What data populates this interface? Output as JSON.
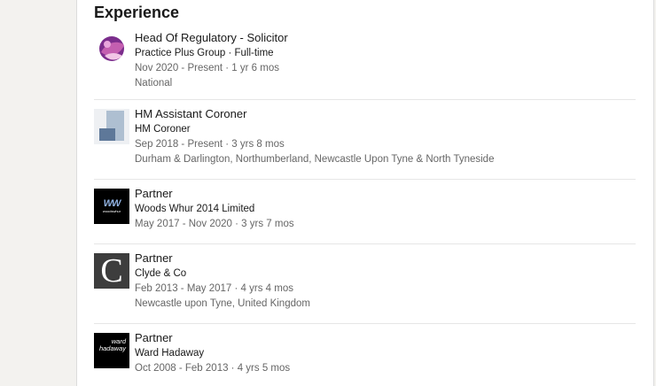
{
  "section": {
    "title": "Experience"
  },
  "entries": [
    {
      "logo": {
        "icon": "practice-plus-group-logo",
        "colors": [
          "#7b2d8c",
          "#c45fb0",
          "#f2c6e6"
        ]
      },
      "title": "Head Of Regulatory - Solicitor",
      "company": "Practice Plus Group · Full-time",
      "dates": "Nov 2020 - Present · 1 yr 6 mos",
      "location": "National"
    },
    {
      "logo": {
        "icon": "hm-coroner-logo",
        "colors": [
          "#aebfd1",
          "#5e7899"
        ]
      },
      "title": "HM Assistant Coroner",
      "company": "HM Coroner",
      "dates": "Sep 2018 - Present · 3 yrs 8 mos",
      "location": "Durham & Darlington, Northumberland, Newcastle Upon Tyne & North Tyneside"
    },
    {
      "logo": {
        "icon": "woods-whur-logo",
        "text_main": "WW",
        "text_sub": "woodswhur"
      },
      "title": "Partner",
      "company": "Woods Whur 2014 Limited",
      "dates": "May 2017 - Nov 2020 · 3 yrs 7 mos",
      "location": ""
    },
    {
      "logo": {
        "icon": "clyde-and-co-logo",
        "text_main": "C"
      },
      "title": "Partner",
      "company": "Clyde & Co",
      "dates": "Feb 2013 - May 2017 · 4 yrs 4 mos",
      "location": "Newcastle upon Tyne, United Kingdom"
    },
    {
      "logo": {
        "icon": "ward-hadaway-logo",
        "text_main": "ward hadaway"
      },
      "title": "Partner",
      "company": "Ward Hadaway",
      "dates": "Oct 2008 - Feb 2013 · 4 yrs 5 mos",
      "location": ""
    }
  ]
}
